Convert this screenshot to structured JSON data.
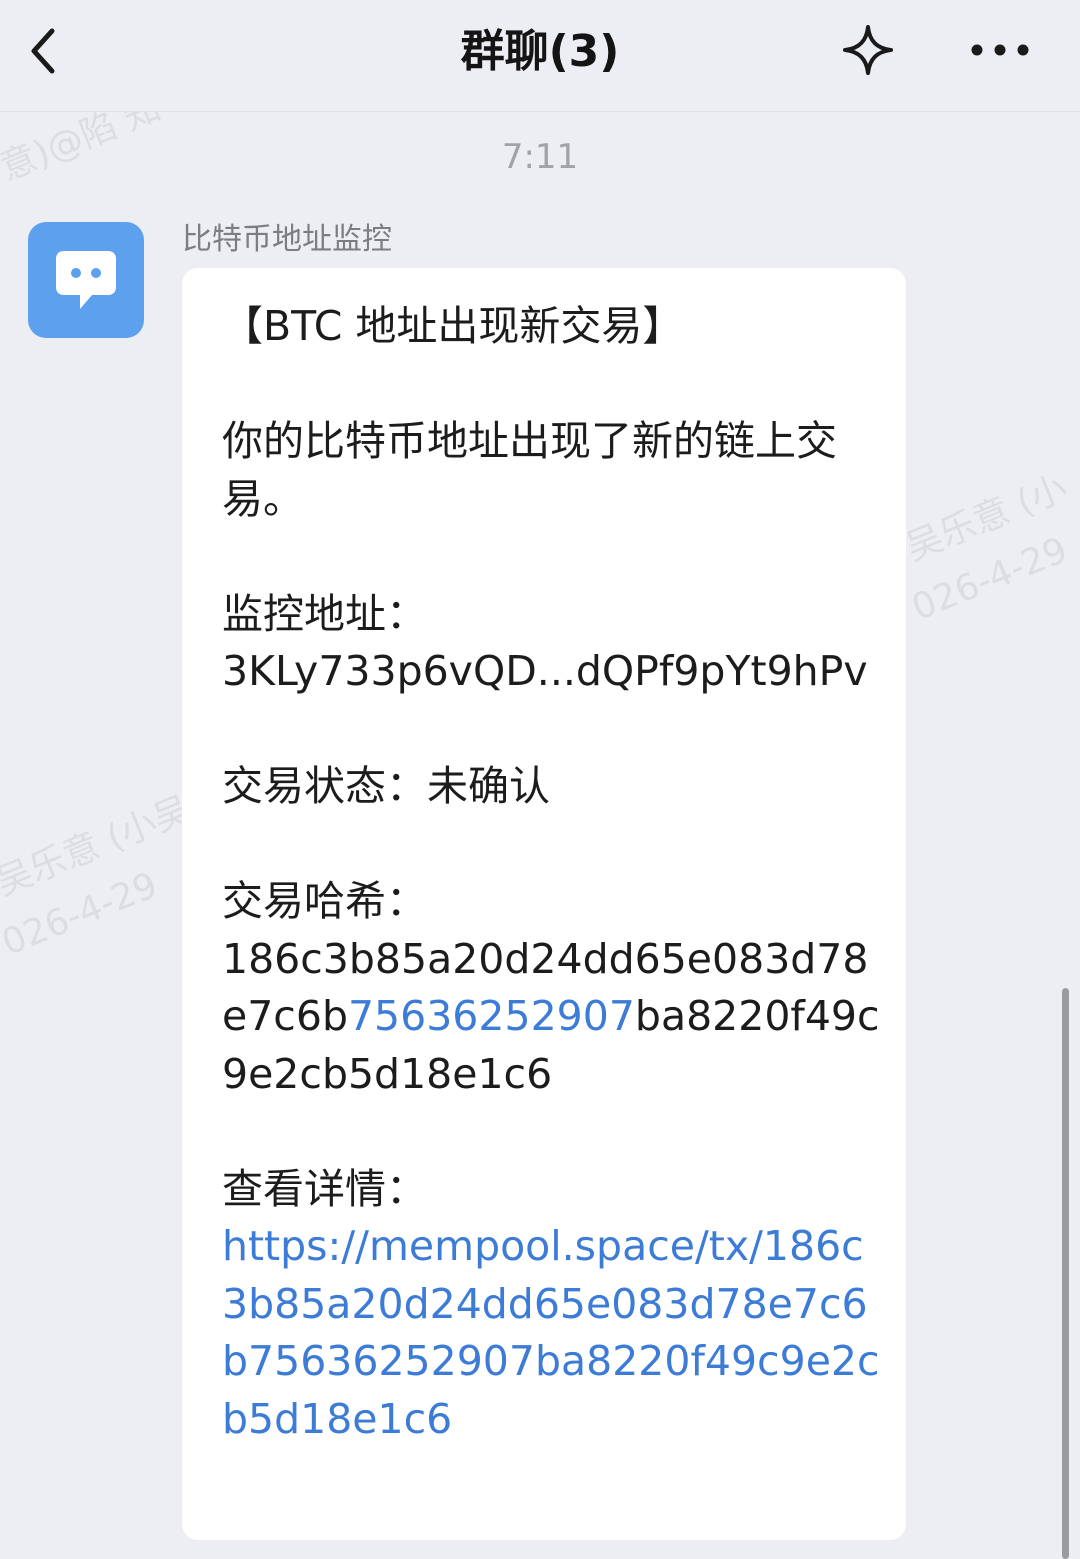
{
  "nav": {
    "title": "群聊(3)",
    "back_icon": "chevron-left-icon",
    "star_icon": "sparkle-star-icon",
    "more_icon": "more-dots-icon"
  },
  "timestamp": "7:11",
  "message": {
    "sender": "比特币地址监控",
    "avatar_icon": "chat-bubble-icon",
    "heading": "【BTC 地址出现新交易】",
    "intro": "你的比特币地址出现了新的链上交易。",
    "address_label": "监控地址：",
    "address_value": "3KLy733p6vQD...dQPf9pYt9hPv",
    "status_label": "交易状态：",
    "status_value": "未确认",
    "hash_label": "交易哈希：",
    "hash_part1": "186c3b85a20d24dd65e083d78e7c6b",
    "hash_highlight": "75636252907",
    "hash_part2": "ba8220f49c9e2cb5d18e1c6",
    "details_label": "查看详情：",
    "details_url": "https://mempool.space/tx/186c3b85a20d24dd65e083d78e7c6b75636252907ba8220f49c9e2cb5d18e1c6"
  },
  "watermarks": {
    "w1": "意)@陷 知",
    "w2a": "吴乐意 (小",
    "w2b": "026-4-29",
    "w3a": "吴乐意 (小吴",
    "w3b": "026-4-29"
  },
  "colors": {
    "background": "#EDEEF3",
    "bubble": "#FFFFFF",
    "avatar": "#5CA0EE",
    "link": "#3C7BD6"
  }
}
